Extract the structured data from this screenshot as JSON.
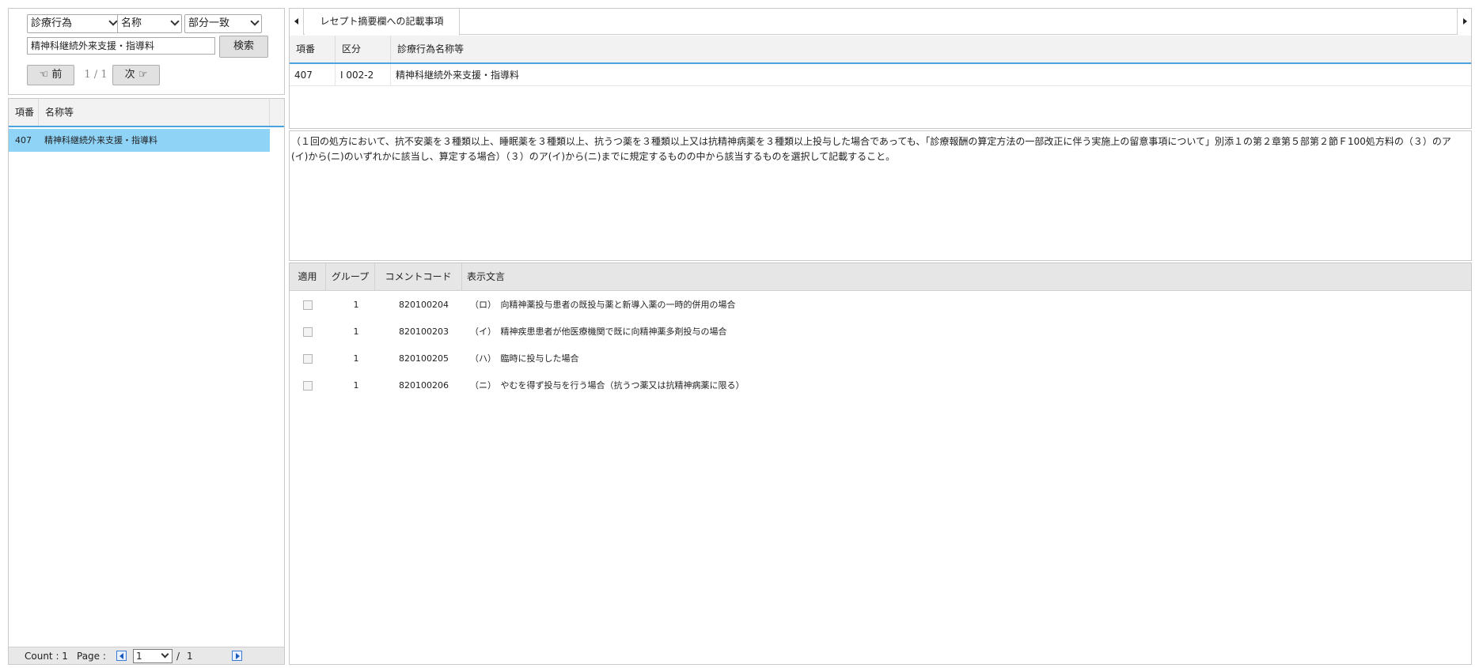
{
  "search": {
    "category": "診療行為",
    "field": "名称",
    "match": "部分一致",
    "keyword": "精神科継続外来支援・指導料",
    "search_label": "検索",
    "prev_label": "☜ 前",
    "next_label": "次 ☞",
    "page_indicator": "1 / 1"
  },
  "left_grid": {
    "headers": [
      "項番",
      "名称等"
    ],
    "rows": [
      {
        "no": "407",
        "name": "精神科継続外来支援・指導料"
      }
    ],
    "footer": {
      "count_text": "Count : 1",
      "page_label": "Page :",
      "page_value": "1",
      "page_sep": "/",
      "page_total": "1"
    }
  },
  "detail_tab": {
    "label": "レセプト摘要欄への記載事項"
  },
  "detail_grid": {
    "headers": [
      "項番",
      "区分",
      "診療行為名称等"
    ],
    "rows": [
      {
        "no": "407",
        "kubun": "I 002-2",
        "name": "精神科継続外来支援・指導料"
      }
    ]
  },
  "description": "（１回の処方において、抗不安薬を３種類以上、睡眠薬を３種類以上、抗うつ薬を３種類以上又は抗精神病薬を３種類以上投与した場合であっても、「診療報酬の算定方法の一部改正に伴う実施上の留意事項について」別添１の第２章第５部第２節Ｆ100処方料の（３）のア(イ)から(ニ)のいずれかに該当し、算定する場合）（３）のア(イ)から(ニ)までに規定するものの中から該当するものを選択して記載すること。",
  "comment_grid": {
    "headers": [
      "適用",
      "グループ",
      "コメントコード",
      "表示文言"
    ],
    "rows": [
      {
        "apply": false,
        "group": "1",
        "code": "820100204",
        "text": "（ロ）　向精神薬投与患者の既投与薬と新導入薬の一時的併用の場合"
      },
      {
        "apply": false,
        "group": "1",
        "code": "820100203",
        "text": "（イ）　精神疾患患者が他医療機関で既に向精神薬多剤投与の場合"
      },
      {
        "apply": false,
        "group": "1",
        "code": "820100205",
        "text": "（ハ）　臨時に投与した場合"
      },
      {
        "apply": false,
        "group": "1",
        "code": "820100206",
        "text": "（ニ）　やむを得ず投与を行う場合（抗うつ薬又は抗精神病薬に限る）"
      }
    ]
  },
  "colors": {
    "selected_row": "#8fd3f7",
    "header_accent": "#4aa3df"
  }
}
